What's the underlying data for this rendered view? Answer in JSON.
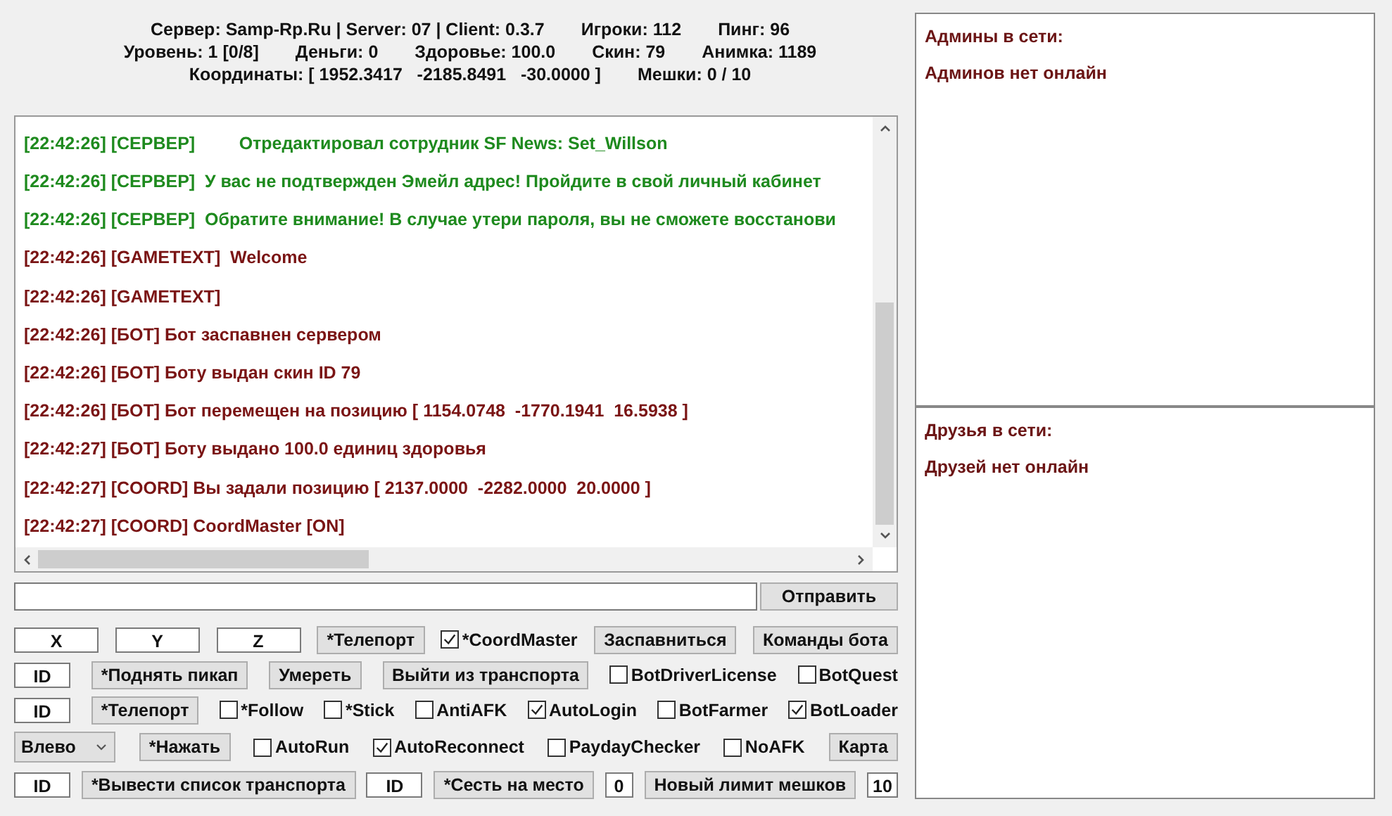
{
  "header": [
    [
      "Сервер: Samp-Rp.Ru | Server: 07 | Client: 0.3.7",
      "Игроки: 112",
      "Пинг: 96"
    ],
    [
      "Уровень: 1 [0/8]",
      "Деньги: 0",
      "Здоровье: 100.0",
      "Скин: 79",
      "Анимка: 1189"
    ],
    [
      "Координаты: [ 1952.3417   -2185.8491   -30.0000 ]",
      "Мешки: 0 / 10"
    ]
  ],
  "log": [
    {
      "text": "[22:42:26] [СЕРВЕР]         Отредактировал сотрудник SF News: Set_Willson",
      "color": "#1e8a1e"
    },
    {
      "text": "[22:42:26] [СЕРВЕР]  У вас не подтвержден Эмейл адрес! Пройдите в свой личный кабинет",
      "color": "#1e8a1e"
    },
    {
      "text": "[22:42:26] [СЕРВЕР]  Обратите внимание! В случае утери пароля, вы не сможете восстанови",
      "color": "#1e8a1e"
    },
    {
      "text": "[22:42:26] [GAMETEXT]  Welcome",
      "color": "#7a1414"
    },
    {
      "text": "[22:42:26] [GAMETEXT]",
      "color": "#7a1414"
    },
    {
      "text": "[22:42:26] [БОТ] Бот заспавнен сервером",
      "color": "#7a1414"
    },
    {
      "text": "[22:42:26] [БОТ] Боту выдан скин ID 79",
      "color": "#7a1414"
    },
    {
      "text": "[22:42:26] [БОТ] Бот перемещен на позицию [ 1154.0748  -1770.1941  16.5938 ]",
      "color": "#7a1414"
    },
    {
      "text": "[22:42:27] [БОТ] Боту выдано 100.0 единиц здоровья",
      "color": "#7a1414"
    },
    {
      "text": "[22:42:27] [COORD] Вы задали позицию [ 2137.0000  -2282.0000  20.0000 ]",
      "color": "#7a1414"
    },
    {
      "text": "[22:42:27] [COORD] CoordMaster [ON]",
      "color": "#7a1414"
    }
  ],
  "send_button": "Отправить",
  "control_rows": [
    [
      {
        "kind": "coord-field",
        "value": "X"
      },
      {
        "kind": "coord-field",
        "value": "Y"
      },
      {
        "kind": "coord-field",
        "value": "Z"
      },
      {
        "kind": "button",
        "label": "*Телепорт"
      },
      {
        "kind": "checkbox",
        "label": "*CoordMaster",
        "checked": true
      },
      {
        "kind": "button",
        "label": "Заспавниться"
      },
      {
        "kind": "button",
        "label": "Команды бота"
      }
    ],
    [
      {
        "kind": "id-field",
        "value": "ID"
      },
      {
        "kind": "button",
        "label": "*Поднять пикап"
      },
      {
        "kind": "button",
        "label": "Умереть"
      },
      {
        "kind": "button",
        "label": "Выйти из транспорта"
      },
      {
        "kind": "checkbox",
        "label": "BotDriverLicense",
        "checked": false
      },
      {
        "kind": "checkbox",
        "label": "BotQuest",
        "checked": false
      }
    ],
    [
      {
        "kind": "id-field",
        "value": "ID"
      },
      {
        "kind": "button",
        "label": "*Телепорт"
      },
      {
        "kind": "checkbox",
        "label": "*Follow",
        "checked": false
      },
      {
        "kind": "checkbox",
        "label": "*Stick",
        "checked": false
      },
      {
        "kind": "checkbox",
        "label": "AntiAFK",
        "checked": false
      },
      {
        "kind": "checkbox",
        "label": "AutoLogin",
        "checked": true
      },
      {
        "kind": "checkbox",
        "label": "BotFarmer",
        "checked": false
      },
      {
        "kind": "checkbox",
        "label": "BotLoader",
        "checked": true
      }
    ],
    [
      {
        "kind": "select",
        "value": "Влево"
      },
      {
        "kind": "button",
        "label": "*Нажать"
      },
      {
        "kind": "checkbox",
        "label": "AutoRun",
        "checked": false
      },
      {
        "kind": "checkbox",
        "label": "AutoReconnect",
        "checked": true
      },
      {
        "kind": "checkbox",
        "label": "PaydayChecker",
        "checked": false
      },
      {
        "kind": "checkbox",
        "label": "NoAFK",
        "checked": false
      },
      {
        "kind": "button",
        "label": "Карта"
      }
    ],
    [
      {
        "kind": "id-field",
        "value": "ID"
      },
      {
        "kind": "button",
        "label": "*Вывести список транспорта"
      },
      {
        "kind": "id-field",
        "value": "ID"
      },
      {
        "kind": "button",
        "label": "*Сесть на место"
      },
      {
        "kind": "number-field",
        "value": "0"
      },
      {
        "kind": "button",
        "label": "Новый лимит мешков"
      },
      {
        "kind": "number-field",
        "value": "10"
      }
    ]
  ],
  "panels": [
    {
      "title": "Админы в сети:",
      "message": "Админов нет онлайн"
    },
    {
      "title": "Друзья в сети:",
      "message": "Друзей нет онлайн"
    }
  ]
}
